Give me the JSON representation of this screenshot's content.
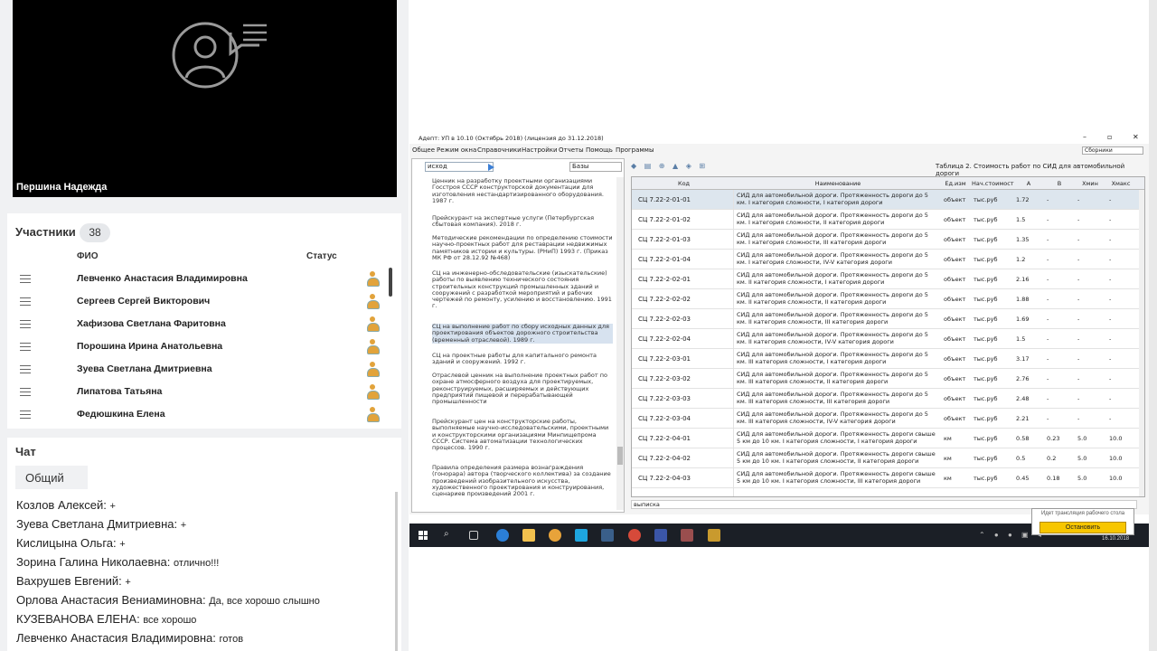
{
  "video": {
    "speaker_name": "Першина Надежда",
    "avatar_icon": "user-speech-icon"
  },
  "participants": {
    "title": "Участники",
    "count": "38",
    "col_name": "ФИО",
    "col_status": "Статус",
    "items": [
      {
        "name": "Левченко Анастасия  Владимировна"
      },
      {
        "name": "Сергеев Сергей Викторович"
      },
      {
        "name": "Хафизова  Светлана  Фаритовна"
      },
      {
        "name": "Порошина  Ирина  Анатольевна"
      },
      {
        "name": "Зуева Светлана Дмитриевна"
      },
      {
        "name": "Липатова Татьяна"
      },
      {
        "name": "Федюшкина Елена"
      }
    ]
  },
  "chat": {
    "title": "Чат",
    "tab": "Общий",
    "messages": [
      {
        "author": "Козлов Алексей:",
        "text": "+"
      },
      {
        "author": "Зуева Светлана Дмитриевна:",
        "text": "+"
      },
      {
        "author": "Кислицына  Ольга:",
        "text": "+"
      },
      {
        "author": "Зорина Галина  Николаевна:",
        "text": "отлично!!!"
      },
      {
        "author": "Вахрушев Евгений:",
        "text": "+"
      },
      {
        "author": "Орлова  Анастасия  Вениаминовна:",
        "text": "Да, все хорошо слышно"
      },
      {
        "author": "КУЗЕВАНОВА ЕЛЕНА:",
        "text": "все хорошо"
      },
      {
        "author": "Левченко Анастасия  Владимировна:",
        "text": "готов"
      }
    ]
  },
  "app": {
    "title": "Адепт: УП в 10.10 (Октябрь 2018) (лицензия до 31.12.2018)",
    "menu": [
      "Общее",
      "Режим окна",
      "Справочники",
      "Настройки",
      "Отчеты",
      "Помощь",
      "Программы"
    ],
    "catalog_select": "Сборники",
    "search_value": "исход",
    "filter_select": "Базы",
    "table_title": "Таблица 2. Стоимость работ по СИД для автомобильной дороги",
    "bottom_search": "выписка",
    "tree_items": [
      "Ценник на разработку проектными организациями Госстроя СССР конструкторской документации для изготовления нестандартизированного оборудования. 1987 г.",
      "Прейскурант на экспертные услуги (Петербургская сбытовая компания). 2018 г.",
      "Методические рекомендации по определению стоимости научно-проектных работ для реставрации недвижимых памятников истории и культуры. (РНиП) 1993 г. (Приказ МК РФ от 28.12.92 №468)",
      "СЦ на инженерно-обследовательские (изыскательские) работы по выявлению технического состояния строительных конструкций промышленных зданий и сооружений с разработкой мероприятий и рабочих чертежей по ремонту, усилению и восстановлению. 1991 г.",
      "СЦ на выполнение работ по сбору исходных данных для проектирования объектов дорожного строительства (временный отраслевой). 1989 г.",
      "СЦ на проектные работы для капитального ремонта зданий и сооружений. 1992 г.",
      "Отраслевой ценник на выполнение проектных работ по охране атмосферного воздуха для проектируемых, реконструируемых, расширяемых и действующих предприятий пищевой и перерабатывающей промышленности",
      "Прейскурант цен на конструкторские работы, выполняемые научно-исследовательскими, проектными и конструкторскими организациями Минпищепрома СССР. Система автоматизации технологических процессов. 1990 г.",
      "Правила определения размера вознаграждения (гонорара) автора (творческого коллектива) за создание произведений изобразительного искусства, художественного проектирования и конструирования, сценариев произведений 2001 г."
    ],
    "columns": [
      "Код",
      "Наименование",
      "Ед.изм",
      "Нач.стоимост",
      "А",
      "В",
      "Хмин",
      "Хмакс"
    ],
    "rows": [
      {
        "code": "СЦ 7.22-2-01-01",
        "name": "СИД для автомобильной дороги. Протяженность дороги до 5 км. I категория сложности, I категория дороги",
        "unit": "объект",
        "cost": "тыс.руб",
        "a": "1.72",
        "b": "-",
        "xmin": "-",
        "xmax": "-"
      },
      {
        "code": "СЦ 7.22-2-01-02",
        "name": "СИД для автомобильной дороги. Протяженность дороги до 5 км. I категория сложности, II категория дороги",
        "unit": "объект",
        "cost": "тыс.руб",
        "a": "1.5",
        "b": "-",
        "xmin": "-",
        "xmax": "-"
      },
      {
        "code": "СЦ 7.22-2-01-03",
        "name": "СИД для автомобильной дороги. Протяженность дороги до 5 км. I категория сложности, III категория дороги",
        "unit": "объект",
        "cost": "тыс.руб",
        "a": "1.35",
        "b": "-",
        "xmin": "-",
        "xmax": "-"
      },
      {
        "code": "СЦ 7.22-2-01-04",
        "name": "СИД для автомобильной дороги. Протяженность дороги до 5 км. I категория сложности, IV-V категория дороги",
        "unit": "объект",
        "cost": "тыс.руб",
        "a": "1.2",
        "b": "-",
        "xmin": "-",
        "xmax": "-"
      },
      {
        "code": "СЦ 7.22-2-02-01",
        "name": "СИД для автомобильной дороги. Протяженность дороги до 5 км. II категория сложности, I категория дороги",
        "unit": "объект",
        "cost": "тыс.руб",
        "a": "2.16",
        "b": "-",
        "xmin": "-",
        "xmax": "-"
      },
      {
        "code": "СЦ 7.22-2-02-02",
        "name": "СИД для автомобильной дороги. Протяженность дороги до 5 км. II категория сложности, II категория дороги",
        "unit": "объект",
        "cost": "тыс.руб",
        "a": "1.88",
        "b": "-",
        "xmin": "-",
        "xmax": "-"
      },
      {
        "code": "СЦ 7.22-2-02-03",
        "name": "СИД для автомобильной дороги. Протяженность дороги до 5 км. II категория сложности, III категория дороги",
        "unit": "объект",
        "cost": "тыс.руб",
        "a": "1.69",
        "b": "-",
        "xmin": "-",
        "xmax": "-"
      },
      {
        "code": "СЦ 7.22-2-02-04",
        "name": "СИД для автомобильной дороги. Протяженность дороги до 5 км. II категория сложности, IV-V категория дороги",
        "unit": "объект",
        "cost": "тыс.руб",
        "a": "1.5",
        "b": "-",
        "xmin": "-",
        "xmax": "-"
      },
      {
        "code": "СЦ 7.22-2-03-01",
        "name": "СИД для автомобильной дороги. Протяженность дороги до 5 км. III категория сложности, I категория дороги",
        "unit": "объект",
        "cost": "тыс.руб",
        "a": "3.17",
        "b": "-",
        "xmin": "-",
        "xmax": "-"
      },
      {
        "code": "СЦ 7.22-2-03-02",
        "name": "СИД для автомобильной дороги. Протяженность дороги до 5 км. III категория сложности, II категория дороги",
        "unit": "объект",
        "cost": "тыс.руб",
        "a": "2.76",
        "b": "-",
        "xmin": "-",
        "xmax": "-"
      },
      {
        "code": "СЦ 7.22-2-03-03",
        "name": "СИД для автомобильной дороги. Протяженность дороги до 5 км. III категория сложности, III категория дороги",
        "unit": "объект",
        "cost": "тыс.руб",
        "a": "2.48",
        "b": "-",
        "xmin": "-",
        "xmax": "-"
      },
      {
        "code": "СЦ 7.22-2-03-04",
        "name": "СИД для автомобильной дороги. Протяженность дороги до 5 км. III категория сложности, IV-V категория дороги",
        "unit": "объект",
        "cost": "тыс.руб",
        "a": "2.21",
        "b": "-",
        "xmin": "-",
        "xmax": "-"
      },
      {
        "code": "СЦ 7.22-2-04-01",
        "name": "СИД для автомобильной дороги. Протяженность дороги свыше 5 км до 10 км. I категория сложности, I категория дороги",
        "unit": "км",
        "cost": "тыс.руб",
        "a": "0.58",
        "b": "0.23",
        "xmin": "5.0",
        "xmax": "10.0"
      },
      {
        "code": "СЦ 7.22-2-04-02",
        "name": "СИД для автомобильной дороги. Протяженность дороги свыше 5 км до 10 км. I категория сложности, II категория дороги",
        "unit": "км",
        "cost": "тыс.руб",
        "a": "0.5",
        "b": "0.2",
        "xmin": "5.0",
        "xmax": "10.0"
      },
      {
        "code": "СЦ 7.22-2-04-03",
        "name": "СИД для автомобильной дороги. Протяженность дороги свыше 5 км до 10 км. I категория сложности, III категория дороги",
        "unit": "км",
        "cost": "тыс.руб",
        "a": "0.45",
        "b": "0.18",
        "xmin": "5.0",
        "xmax": "10.0"
      }
    ]
  },
  "taskbar": {
    "clock": "16.10.2018"
  },
  "share": {
    "notice": "Идет трансляция рабочего стола",
    "stop": "Остановить"
  }
}
